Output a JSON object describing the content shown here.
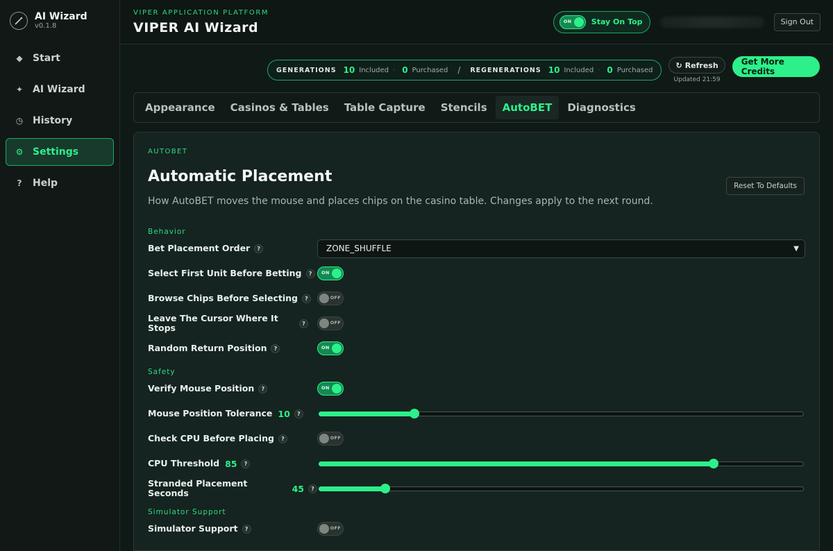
{
  "sidebar": {
    "brand": {
      "title": "AI Wizard",
      "version": "v0.1.8",
      "icon": "wand-icon"
    },
    "items": [
      {
        "label": "Start",
        "icon": "diamond-icon",
        "glyph": "◆",
        "active": false
      },
      {
        "label": "AI Wizard",
        "icon": "sparkle-icon",
        "glyph": "✦",
        "active": false
      },
      {
        "label": "History",
        "icon": "clock-icon",
        "glyph": "◷",
        "active": false
      },
      {
        "label": "Settings",
        "icon": "gear-icon",
        "glyph": "⚙",
        "active": true
      },
      {
        "label": "Help",
        "icon": "question-icon",
        "glyph": "?",
        "active": false
      }
    ]
  },
  "header": {
    "platform": "VIPER APPLICATION PLATFORM",
    "title": "VIPER AI Wizard",
    "stay_on_top": {
      "label": "Stay On Top",
      "state": "ON"
    },
    "sign_out": "Sign Out"
  },
  "credits": {
    "generations": {
      "label": "GENERATIONS",
      "included": "10",
      "included_label": "Included",
      "purchased": "0",
      "purchased_label": "Purchased"
    },
    "separator": "/",
    "regenerations": {
      "label": "REGENERATIONS",
      "included": "10",
      "included_label": "Included",
      "purchased": "0",
      "purchased_label": "Purchased"
    },
    "refresh": "Refresh",
    "updated": "Updated 21:59",
    "get_more": "Get More Credits"
  },
  "tabs": [
    {
      "label": "Appearance",
      "active": false
    },
    {
      "label": "Casinos & Tables",
      "active": false
    },
    {
      "label": "Table Capture",
      "active": false
    },
    {
      "label": "Stencils",
      "active": false
    },
    {
      "label": "AutoBET",
      "active": true
    },
    {
      "label": "Diagnostics",
      "active": false
    }
  ],
  "panel": {
    "kicker": "AUTOBET",
    "title": "Automatic Placement",
    "reset": "Reset To Defaults",
    "description": "How AutoBET moves the mouse and places chips on the casino table. Changes apply to the next round.",
    "sections": {
      "behavior": "Behavior",
      "safety": "Safety",
      "simulator": "Simulator Support"
    },
    "bet_order": {
      "label": "Bet Placement Order",
      "value": "ZONE_SHUFFLE"
    },
    "select_first_unit": {
      "label": "Select First Unit Before Betting",
      "state": "ON"
    },
    "browse_chips": {
      "label": "Browse Chips Before Selecting",
      "state": "OFF"
    },
    "leave_cursor": {
      "label": "Leave The Cursor Where It Stops",
      "state": "OFF"
    },
    "random_return": {
      "label": "Random Return Position",
      "state": "ON"
    },
    "verify_mouse": {
      "label": "Verify Mouse Position",
      "state": "ON"
    },
    "mouse_tolerance": {
      "label": "Mouse Position Tolerance",
      "value": "10",
      "fraction": 0.2
    },
    "check_cpu": {
      "label": "Check CPU Before Placing",
      "state": "OFF"
    },
    "cpu_threshold": {
      "label": "CPU Threshold",
      "value": "85",
      "fraction": 0.815
    },
    "stranded_seconds": {
      "label": "Stranded Placement Seconds",
      "value": "45",
      "fraction": 0.14
    },
    "simulator_support": {
      "label": "Simulator Support",
      "state": "OFF"
    }
  },
  "colors": {
    "accent": "#2df08a",
    "background": "#0f1a17",
    "panel": "#152420"
  }
}
